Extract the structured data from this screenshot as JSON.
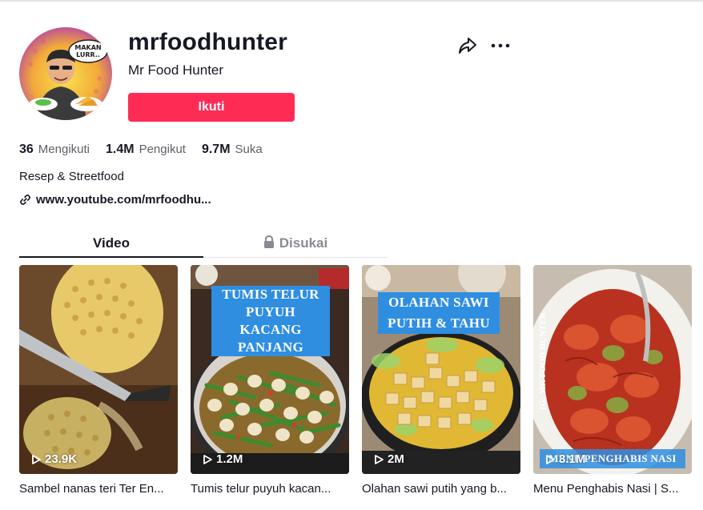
{
  "profile": {
    "username": "mrfoodhunter",
    "nickname": "Mr Food Hunter",
    "follow_label": "Ikuti",
    "avatar_text": "MAKAN LURR..",
    "bio": "Resep & Streetfood",
    "link": "www.youtube.com/mrfoodhu..."
  },
  "stats": [
    {
      "value": "36",
      "label": "Mengikuti"
    },
    {
      "value": "1.4M",
      "label": "Pengikut"
    },
    {
      "value": "9.7M",
      "label": "Suka"
    }
  ],
  "tabs": [
    {
      "label": "Video",
      "active": true
    },
    {
      "label": "Disukai",
      "active": false,
      "icon": "lock-icon"
    }
  ],
  "videos": [
    {
      "views": "23.9K",
      "title": "Sambel nanas teri Ter En..."
    },
    {
      "views": "1.2M",
      "title": "Tumis telur puyuh kacan...",
      "overlay": [
        "TUMIS TELUR",
        "PUYUH KACANG",
        "PANJANG"
      ]
    },
    {
      "views": "2M",
      "title": "Olahan sawi putih yang b...",
      "overlay": [
        "OLAHAN SAWI",
        "PUTIH & TAHU"
      ]
    },
    {
      "views": "3.1M",
      "title": "Menu Penghabis Nasi | S...",
      "overlay": [
        "MENU PENGHABIS NASI"
      ],
      "side_text": "IG: MR FOOD HUNTER"
    }
  ],
  "icons": {
    "share": "share-icon",
    "more": "more-icon",
    "link": "link-icon",
    "play": "play-icon",
    "lock": "lock-icon"
  },
  "colors": {
    "accent": "#fe2c55",
    "text": "#161823",
    "muted": "#8a8b91",
    "overlay_blue": "#2f8ee0"
  }
}
